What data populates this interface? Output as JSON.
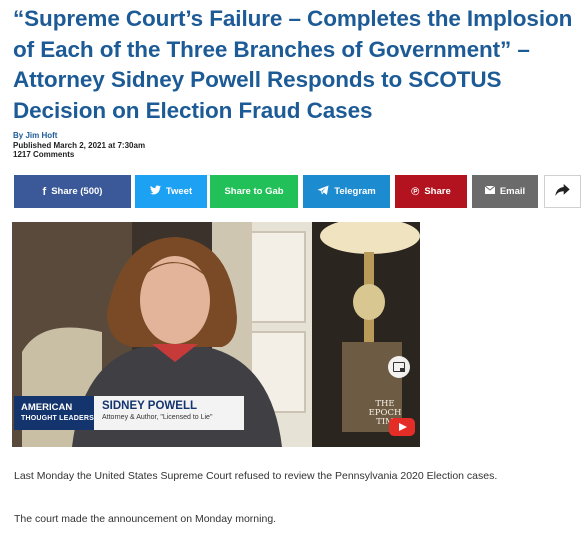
{
  "article": {
    "headline": "“Supreme Court’s Failure – Completes the Implosion of Each of the Three Branches of Government” – Attorney Sidney Powell Responds to SCOTUS Decision on Election Fraud Cases",
    "byline": "By Jim Hoft",
    "published": "Published March 2, 2021 at 7:30am",
    "comments": "1217 Comments"
  },
  "share": {
    "facebook": "Share (500)",
    "twitter": "Tweet",
    "gab": "Share to Gab",
    "telegram": "Telegram",
    "pinterest": "Share",
    "email": "Email",
    "facebook_icon": "f",
    "pinterest_icon": "℗"
  },
  "video": {
    "show_name_line1": "AMERICAN",
    "show_name_line2": "THOUGHT LEADERS",
    "guest_name": "SIDNEY POWELL",
    "guest_title": "Attorney & Author, \"Licensed to Lie\"",
    "watermark_line1": "THE",
    "watermark_line2": "EPOCH",
    "watermark_line3": "TIM"
  },
  "body": {
    "p1": "Last Monday the United States Supreme Court refused to review the Pennsylvania 2020 Election cases.",
    "p2": "The court made the announcement on Monday morning."
  },
  "colors": {
    "headline": "#1d5b97",
    "facebook": "#3b5998",
    "twitter": "#1da1f2",
    "gab": "#21c058",
    "telegram": "#1c8bd0",
    "pinterest": "#b3131e",
    "email": "#6b6b6b"
  }
}
